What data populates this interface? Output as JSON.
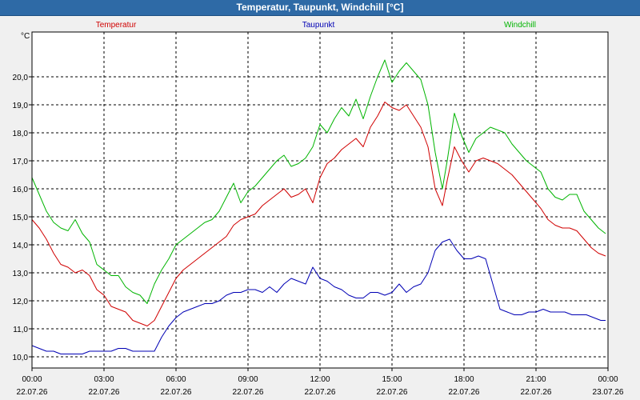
{
  "window": {
    "title": "Temperatur, Taupunkt, Windchill [°C]"
  },
  "chart_data": {
    "type": "line",
    "title": "Temperatur, Taupunkt, Windchill [°C]",
    "ylabel": "°C",
    "xlabel": "",
    "ylim": [
      9.6,
      21.6
    ],
    "xlim": [
      0,
      24
    ],
    "grid": true,
    "legend_position": "top",
    "y_ticks": [
      {
        "value": 10,
        "label": "10,0"
      },
      {
        "value": 11,
        "label": "11,0"
      },
      {
        "value": 12,
        "label": "12,0"
      },
      {
        "value": 13,
        "label": "13,0"
      },
      {
        "value": 14,
        "label": "14,0"
      },
      {
        "value": 15,
        "label": "15,0"
      },
      {
        "value": 16,
        "label": "16,0"
      },
      {
        "value": 17,
        "label": "17,0"
      },
      {
        "value": 18,
        "label": "18,0"
      },
      {
        "value": 19,
        "label": "19,0"
      },
      {
        "value": 20,
        "label": "20,0"
      }
    ],
    "x_ticks": [
      {
        "value": 0,
        "time": "00:00",
        "date": "22.07.26"
      },
      {
        "value": 3,
        "time": "03:00",
        "date": "22.07.26"
      },
      {
        "value": 6,
        "time": "06:00",
        "date": "22.07.26"
      },
      {
        "value": 9,
        "time": "09:00",
        "date": "22.07.26"
      },
      {
        "value": 12,
        "time": "12:00",
        "date": "22.07.26"
      },
      {
        "value": 15,
        "time": "15:00",
        "date": "22.07.26"
      },
      {
        "value": 18,
        "time": "18:00",
        "date": "22.07.26"
      },
      {
        "value": 21,
        "time": "21:00",
        "date": "22.07.26"
      },
      {
        "value": 24,
        "time": "00:00",
        "date": "23.07.26"
      }
    ],
    "series": [
      {
        "name": "Temperatur",
        "color": "#d00000",
        "x": [
          0,
          0.3,
          0.6,
          0.9,
          1.2,
          1.5,
          1.8,
          2.1,
          2.4,
          2.7,
          3.0,
          3.3,
          3.6,
          3.9,
          4.2,
          4.5,
          4.8,
          5.1,
          5.4,
          5.7,
          6.0,
          6.3,
          6.6,
          6.9,
          7.2,
          7.5,
          7.8,
          8.1,
          8.4,
          8.7,
          9.0,
          9.3,
          9.6,
          9.9,
          10.2,
          10.5,
          10.8,
          11.1,
          11.4,
          11.7,
          12.0,
          12.3,
          12.6,
          12.9,
          13.2,
          13.5,
          13.8,
          14.1,
          14.4,
          14.7,
          15.0,
          15.3,
          15.6,
          15.9,
          16.2,
          16.5,
          16.8,
          17.1,
          17.3,
          17.6,
          17.9,
          18.2,
          18.5,
          18.8,
          19.1,
          19.4,
          19.7,
          20.0,
          20.3,
          20.6,
          20.9,
          21.2,
          21.5,
          21.8,
          22.1,
          22.4,
          22.7,
          23.0,
          23.3,
          23.6,
          23.9
        ],
        "values": [
          14.9,
          14.6,
          14.2,
          13.7,
          13.3,
          13.2,
          13.0,
          13.1,
          12.9,
          12.4,
          12.2,
          11.8,
          11.7,
          11.6,
          11.3,
          11.2,
          11.1,
          11.3,
          11.8,
          12.3,
          12.8,
          13.1,
          13.3,
          13.5,
          13.7,
          13.9,
          14.1,
          14.3,
          14.7,
          14.9,
          15.0,
          15.1,
          15.4,
          15.6,
          15.8,
          16.0,
          15.7,
          15.8,
          16.0,
          15.5,
          16.4,
          16.9,
          17.1,
          17.4,
          17.6,
          17.8,
          17.5,
          18.2,
          18.6,
          19.1,
          18.9,
          18.8,
          19.0,
          18.6,
          18.2,
          17.5,
          16.0,
          15.4,
          16.3,
          17.5,
          17.0,
          16.6,
          17.0,
          17.1,
          17.0,
          16.9,
          16.7,
          16.5,
          16.2,
          15.9,
          15.6,
          15.3,
          14.9,
          14.7,
          14.6,
          14.6,
          14.5,
          14.2,
          13.9,
          13.7,
          13.6
        ]
      },
      {
        "name": "Taupunkt",
        "color": "#0000b4",
        "x": [
          0,
          0.3,
          0.6,
          0.9,
          1.2,
          1.5,
          1.8,
          2.1,
          2.4,
          2.7,
          3.0,
          3.3,
          3.6,
          3.9,
          4.2,
          4.5,
          4.8,
          5.1,
          5.4,
          5.7,
          6.0,
          6.3,
          6.6,
          6.9,
          7.2,
          7.5,
          7.8,
          8.1,
          8.4,
          8.7,
          9.0,
          9.3,
          9.6,
          9.9,
          10.2,
          10.5,
          10.8,
          11.1,
          11.4,
          11.7,
          12.0,
          12.3,
          12.6,
          12.9,
          13.2,
          13.5,
          13.8,
          14.1,
          14.4,
          14.7,
          15.0,
          15.3,
          15.6,
          15.9,
          16.2,
          16.5,
          16.8,
          17.1,
          17.4,
          17.7,
          18.0,
          18.3,
          18.6,
          18.9,
          19.2,
          19.5,
          19.8,
          20.1,
          20.4,
          20.7,
          21.0,
          21.3,
          21.6,
          21.9,
          22.2,
          22.5,
          22.8,
          23.1,
          23.4,
          23.7,
          23.9
        ],
        "values": [
          10.4,
          10.3,
          10.2,
          10.2,
          10.1,
          10.1,
          10.1,
          10.1,
          10.2,
          10.2,
          10.2,
          10.2,
          10.3,
          10.3,
          10.2,
          10.2,
          10.2,
          10.2,
          10.7,
          11.1,
          11.4,
          11.6,
          11.7,
          11.8,
          11.9,
          11.9,
          12.0,
          12.2,
          12.3,
          12.3,
          12.4,
          12.4,
          12.3,
          12.5,
          12.3,
          12.6,
          12.8,
          12.7,
          12.6,
          13.2,
          12.8,
          12.7,
          12.5,
          12.4,
          12.2,
          12.1,
          12.1,
          12.3,
          12.3,
          12.2,
          12.3,
          12.6,
          12.3,
          12.5,
          12.6,
          13.0,
          13.8,
          14.1,
          14.2,
          13.8,
          13.5,
          13.5,
          13.6,
          13.5,
          12.6,
          11.7,
          11.6,
          11.5,
          11.5,
          11.6,
          11.6,
          11.7,
          11.6,
          11.6,
          11.6,
          11.5,
          11.5,
          11.5,
          11.4,
          11.3,
          11.3
        ]
      },
      {
        "name": "Windchill",
        "color": "#00b400",
        "x": [
          0,
          0.3,
          0.6,
          0.9,
          1.2,
          1.5,
          1.8,
          2.1,
          2.4,
          2.7,
          3.0,
          3.3,
          3.6,
          3.9,
          4.2,
          4.5,
          4.8,
          5.1,
          5.4,
          5.7,
          6.0,
          6.3,
          6.6,
          6.9,
          7.2,
          7.5,
          7.8,
          8.1,
          8.4,
          8.7,
          9.0,
          9.3,
          9.6,
          9.9,
          10.2,
          10.5,
          10.8,
          11.1,
          11.4,
          11.7,
          12.0,
          12.3,
          12.6,
          12.9,
          13.2,
          13.5,
          13.8,
          14.1,
          14.4,
          14.7,
          15.0,
          15.3,
          15.6,
          15.9,
          16.2,
          16.5,
          16.8,
          17.1,
          17.3,
          17.6,
          17.9,
          18.2,
          18.5,
          18.8,
          19.1,
          19.4,
          19.7,
          20.0,
          20.3,
          20.6,
          20.9,
          21.2,
          21.5,
          21.8,
          22.1,
          22.4,
          22.7,
          23.0,
          23.3,
          23.6,
          23.9
        ],
        "values": [
          16.4,
          15.8,
          15.2,
          14.8,
          14.6,
          14.5,
          14.9,
          14.4,
          14.1,
          13.3,
          13.1,
          12.9,
          12.9,
          12.5,
          12.3,
          12.2,
          11.9,
          12.6,
          13.1,
          13.5,
          14.0,
          14.2,
          14.4,
          14.6,
          14.8,
          14.9,
          15.2,
          15.7,
          16.2,
          15.5,
          15.9,
          16.1,
          16.4,
          16.7,
          17.0,
          17.2,
          16.8,
          16.9,
          17.1,
          17.5,
          18.3,
          18.0,
          18.5,
          18.9,
          18.6,
          19.2,
          18.5,
          19.3,
          20.0,
          20.6,
          19.8,
          20.2,
          20.5,
          20.2,
          19.9,
          19.0,
          17.3,
          16.0,
          17.0,
          18.7,
          17.9,
          17.3,
          17.8,
          18.0,
          18.2,
          18.1,
          18.0,
          17.6,
          17.3,
          17.0,
          16.8,
          16.6,
          16.0,
          15.7,
          15.6,
          15.8,
          15.8,
          15.2,
          14.9,
          14.6,
          14.4
        ]
      }
    ]
  }
}
